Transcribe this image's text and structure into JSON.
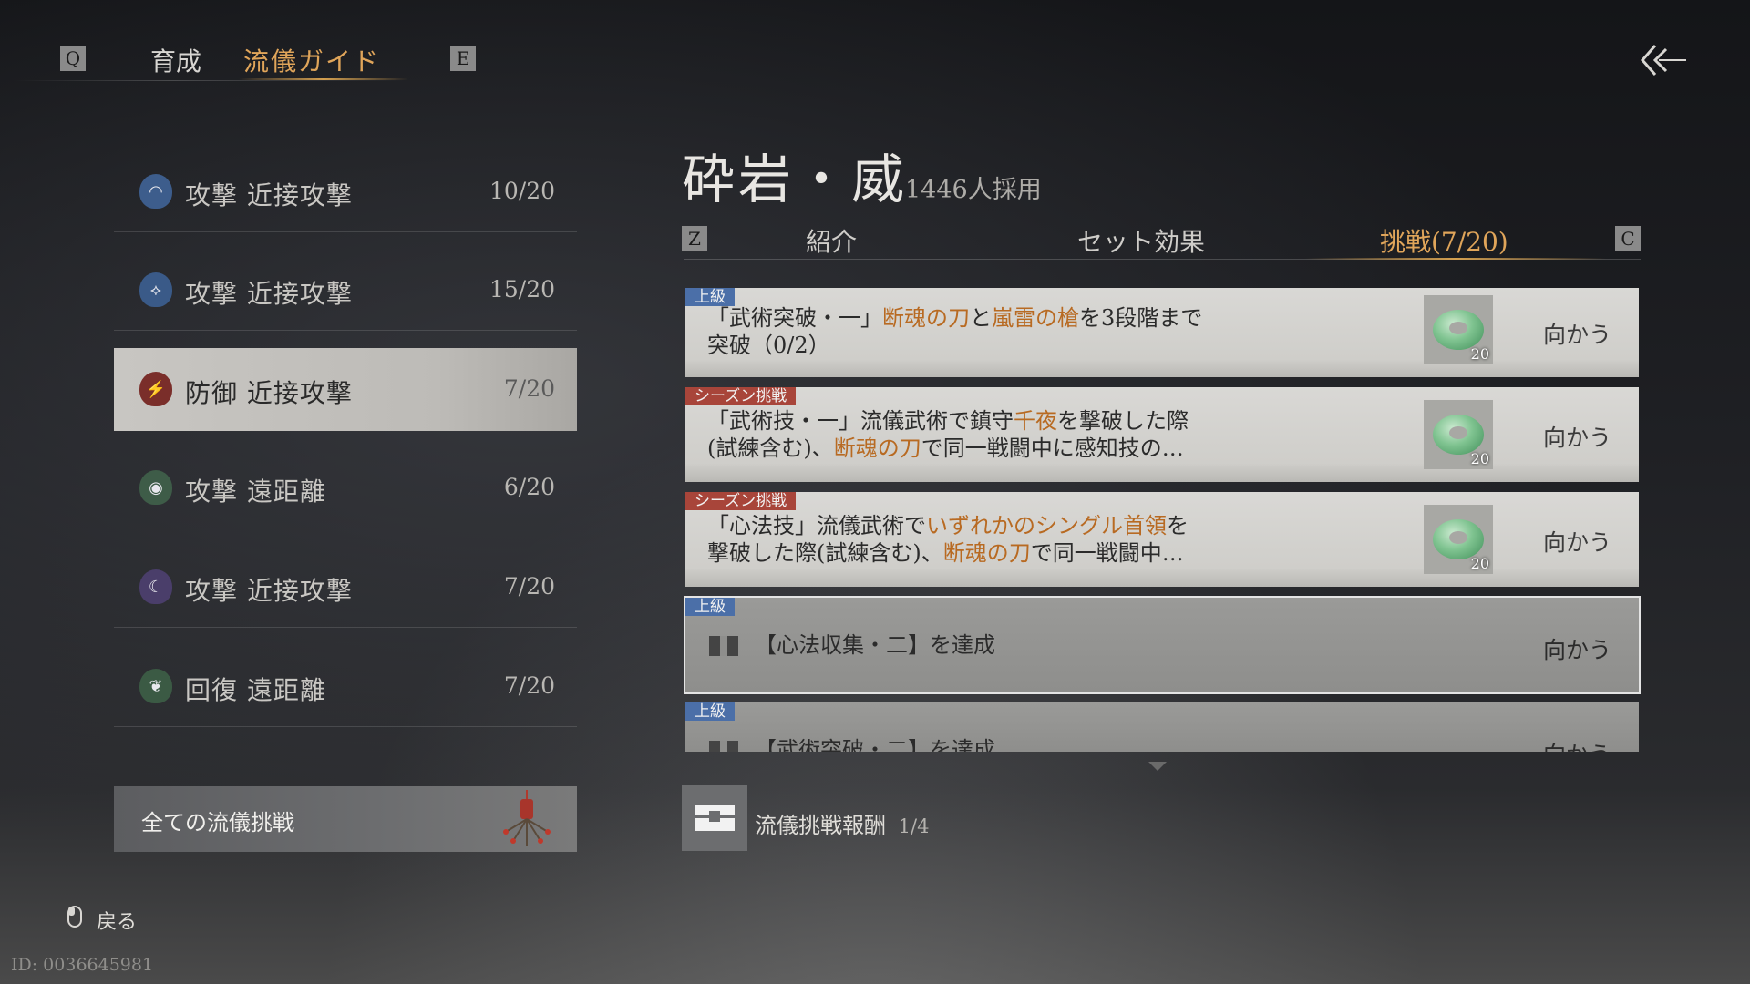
{
  "top_nav": {
    "left_key": "Q",
    "tabs": [
      "育成",
      "流儀ガイド"
    ],
    "right_key": "E"
  },
  "style_list": [
    {
      "label": "攻撃 近接攻撃",
      "count": "10/20",
      "icon": "fan-wave-icon"
    },
    {
      "label": "攻撃 近接攻撃",
      "count": "15/20",
      "icon": "blade-icon"
    },
    {
      "label": "防御 近接攻撃",
      "count": "7/20",
      "icon": "shield-icon"
    },
    {
      "label": "攻撃 遠距離",
      "count": "6/20",
      "icon": "swirl-icon"
    },
    {
      "label": "攻撃 近接攻撃",
      "count": "7/20",
      "icon": "crescent-icon"
    },
    {
      "label": "回復 遠距離",
      "count": "7/20",
      "icon": "leaf-icon"
    }
  ],
  "all_challenges_label": "全ての流儀挑戦",
  "back_label": "戻る",
  "id_text": "ID: 0036645981",
  "header": {
    "title": "砕岩・威",
    "subtitle": "1446人採用"
  },
  "tabs": {
    "left_key": "Z",
    "items": [
      "紹介",
      "セット効果",
      "挑戦(7/20)"
    ],
    "right_key": "C"
  },
  "challenges": [
    {
      "tag": "上級",
      "line1_parts": [
        "「武術突破・一」",
        "断魂の刀",
        "と",
        "嵐雷の槍",
        "を3段階まで"
      ],
      "line2_parts": [
        "突破（0/2）"
      ],
      "reward_count": "20",
      "go": "向かう"
    },
    {
      "tag": "シーズン挑戦",
      "line1_parts": [
        "「武術技・一」流儀武術で鎮守",
        "千夜",
        "を撃破した際"
      ],
      "line2_parts": [
        "(試練含む)、",
        "断魂の刀",
        "で同一戦闘中に感知技の…"
      ],
      "reward_count": "20",
      "go": "向かう"
    },
    {
      "tag": "シーズン挑戦",
      "line1_parts": [
        "「心法技」流儀武術で",
        "いずれかのシングル首領",
        "を"
      ],
      "line2_parts": [
        "撃破した際(試練含む)、",
        "断魂の刀",
        "で同一戦闘中…"
      ],
      "reward_count": "20",
      "go": "向かう"
    },
    {
      "tag": "上級",
      "text": "【心法収集・二】を達成",
      "go": "向かう"
    },
    {
      "tag": "上級",
      "text": "【武術突破・二】を達成",
      "go": "向かう"
    }
  ],
  "reward_progress": {
    "label": "流儀挑戦報酬",
    "count": "1/4"
  },
  "colors": {
    "accent_gold": "#e0a55a",
    "highlight_orange": "#b86a22",
    "tag_blue": "#4b6fa8",
    "tag_red": "#a8453a"
  }
}
